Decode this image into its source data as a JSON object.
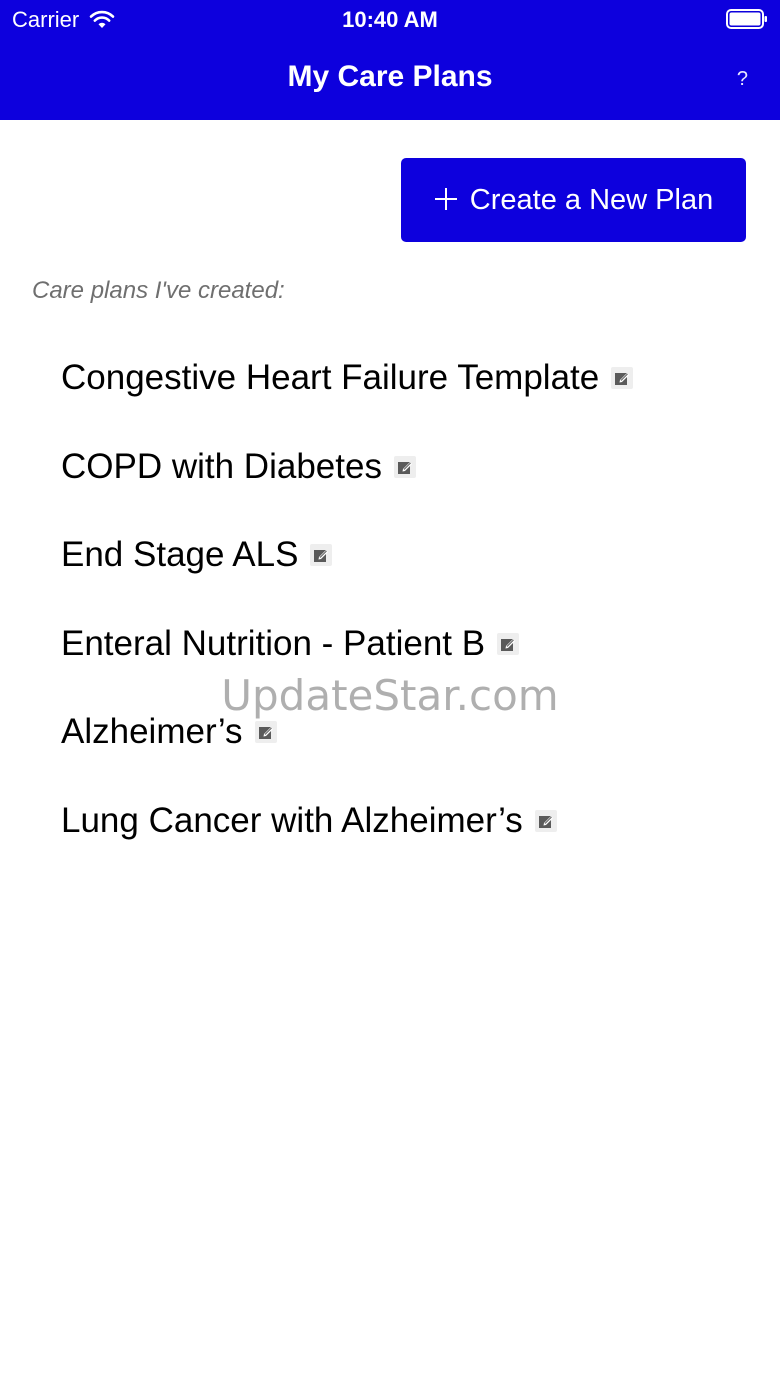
{
  "status_bar": {
    "carrier": "Carrier",
    "time": "10:40 AM"
  },
  "nav": {
    "title": "My Care Plans",
    "help_label": "?"
  },
  "create_button": {
    "icon": "plus-icon",
    "label": "Create a New Plan"
  },
  "section_label": "Care plans I've created:",
  "plans": [
    {
      "name": "Congestive Heart Failure Template",
      "icon": "edit-icon"
    },
    {
      "name": "COPD with Diabetes",
      "icon": "edit-icon"
    },
    {
      "name": "End Stage ALS",
      "icon": "edit-icon"
    },
    {
      "name": "Enteral Nutrition - Patient B",
      "icon": "edit-icon"
    },
    {
      "name": "Alzheimer’s",
      "icon": "edit-icon"
    },
    {
      "name": "Lung Cancer with Alzheimer’s",
      "icon": "edit-icon"
    }
  ],
  "watermark": "UpdateStar.com",
  "colors": {
    "primary": "#0d00dd",
    "background": "#ffffff",
    "muted_text": "#6f6f6f",
    "text": "#000000"
  }
}
